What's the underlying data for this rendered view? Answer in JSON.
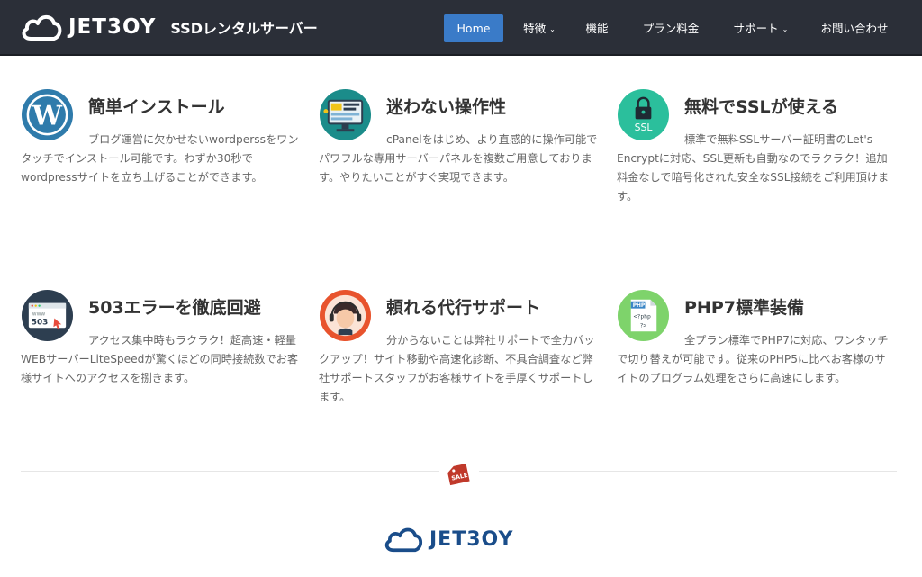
{
  "header": {
    "logo_text": "JET3OY",
    "logo_subtitle": "SSDレンタルサーバー",
    "nav": [
      {
        "label": "Home",
        "active": true
      },
      {
        "label": "特徴",
        "has_dropdown": true
      },
      {
        "label": "機能"
      },
      {
        "label": "プラン料金"
      },
      {
        "label": "サポート",
        "has_dropdown": true
      },
      {
        "label": "お問い合わせ"
      }
    ]
  },
  "features": [
    {
      "icon": "wordpress-icon",
      "title": "簡単インストール",
      "description": "ブログ運営に欠かせないwordperssをワンタッチでインストール可能です。わずか30秒でwordpressサイトを立ち上げることができます。"
    },
    {
      "icon": "control-panel-icon",
      "title": "迷わない操作性",
      "description": "cPanelをはじめ、より直感的に操作可能でパワフルな専用サーバーパネルを複数ご用意しております。やりたいことがすぐ実現できます。"
    },
    {
      "icon": "ssl-lock-icon",
      "icon_label": "SSL",
      "title": "無料でSSLが使える",
      "description": "標準で無料SSLサーバー証明書のLet's Encryptに対応、SSL更新も自動なのでラクラク！追加料金なしで暗号化された安全なSSL接続をご利用頂けます。"
    },
    {
      "icon": "error-503-icon",
      "icon_label_small": "www",
      "icon_label": "503",
      "title": "503エラーを徹底回避",
      "description": "アクセス集中時もラクラク！超高速・軽量WEBサーバーLiteSpeedが驚くほどの同時接続数でお客様サイトへのアクセスを捌きます。"
    },
    {
      "icon": "support-headset-icon",
      "title": "頼れる代行サポート",
      "description": "分からないことは弊社サポートで全力バックアップ！サイト移動や高速化診断、不具合調査など弊社サポートスタッフがお客様サイトを手厚くサポートします。"
    },
    {
      "icon": "php-file-icon",
      "icon_label_small": "PHP",
      "icon_label": "<?php",
      "icon_label_2": "?>",
      "title": "PHP7標準装備",
      "description": "全プラン標準でPHP7に対応、ワンタッチで切り替えが可能です。従来のPHP5に比べお客様のサイトのプログラム処理をさらに高速にします。"
    }
  ],
  "divider": {
    "badge": "SALE"
  },
  "footer": {
    "logo_text": "JET3OY"
  },
  "colors": {
    "header_bg": "#2b2f38",
    "nav_active": "#3a7bc8",
    "brand_blue": "#1a4d8a"
  }
}
